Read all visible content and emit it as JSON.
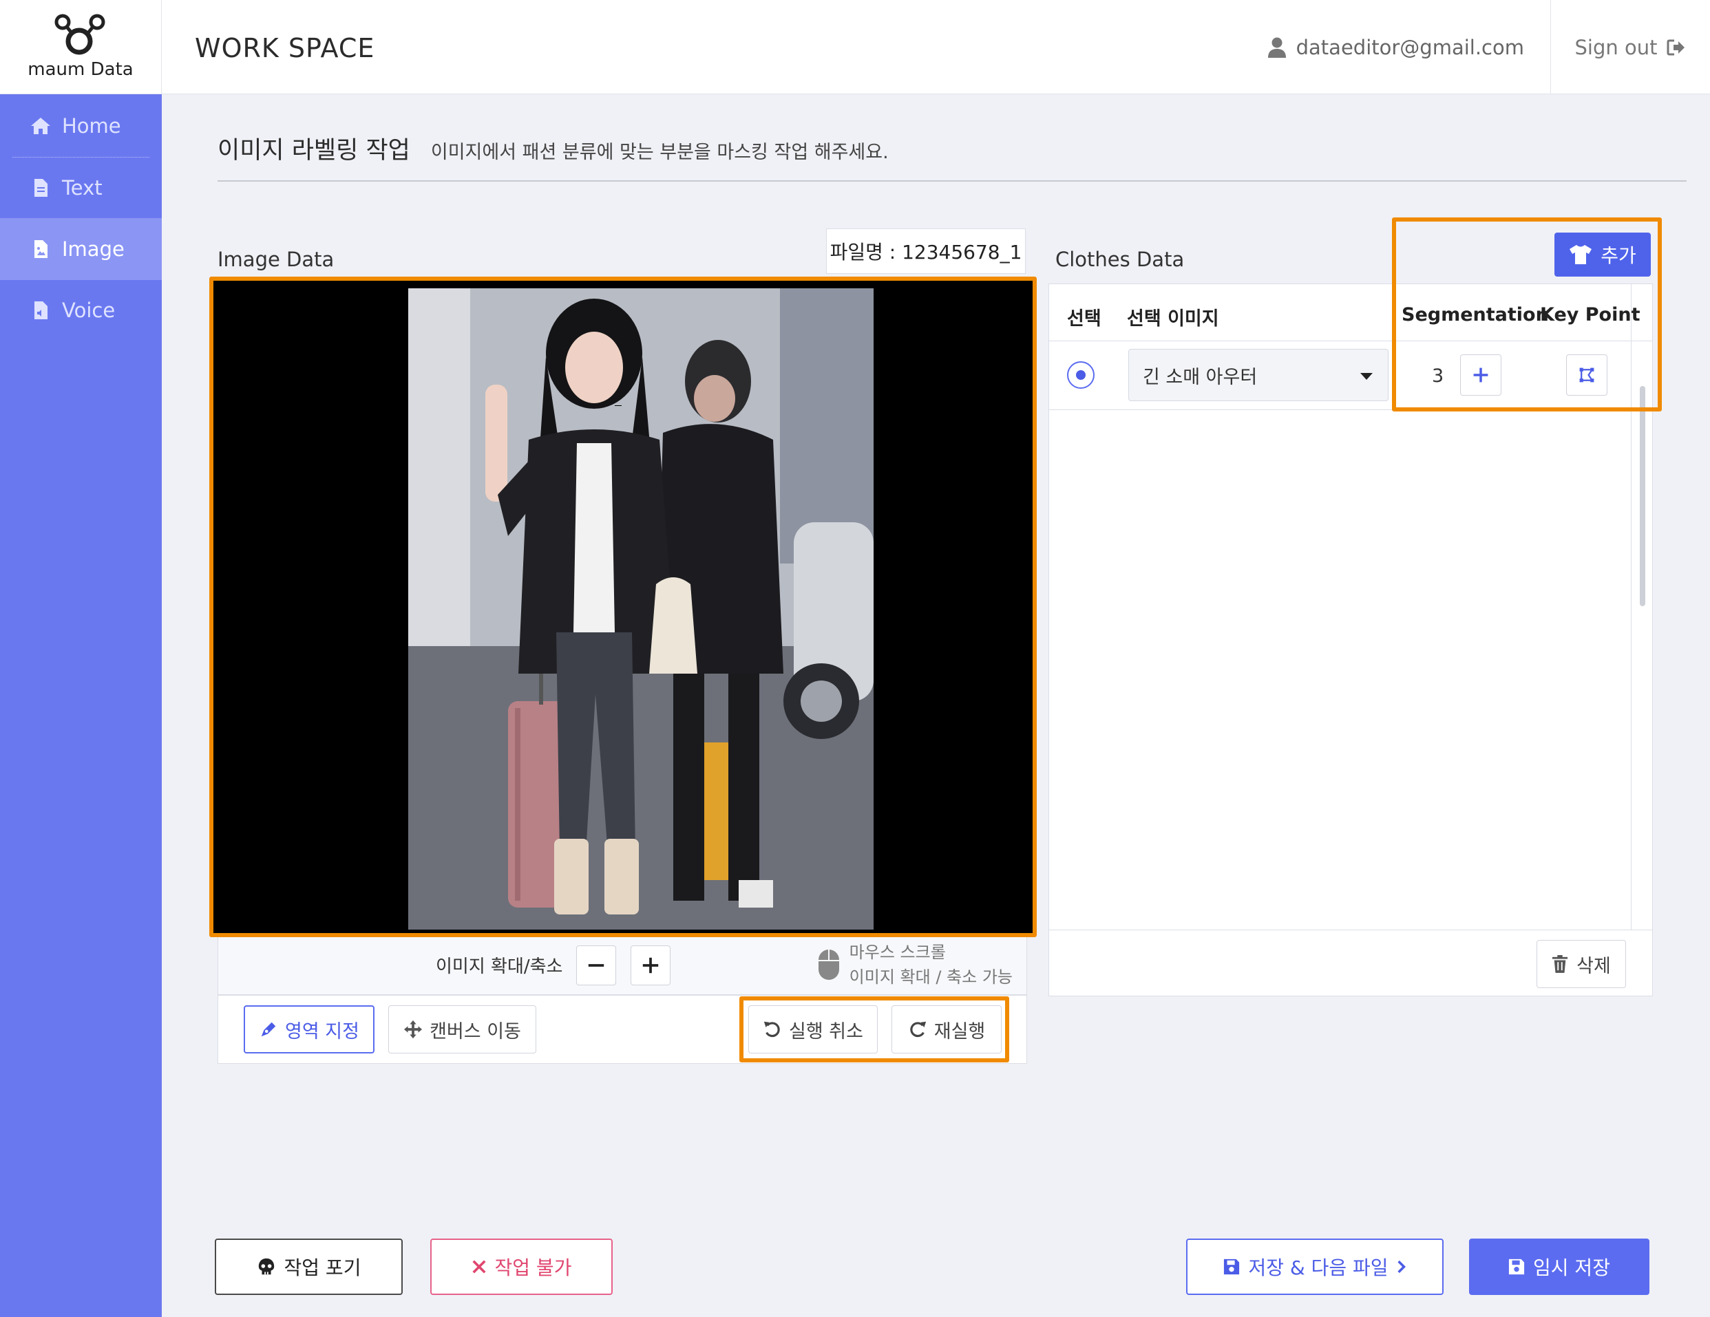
{
  "app": {
    "logo_text": "maum Data",
    "workspace_title": "WORK SPACE"
  },
  "header": {
    "user_email": "dataeditor@gmail.com",
    "signout_label": "Sign out"
  },
  "sidebar": {
    "items": [
      {
        "label": "Home",
        "icon": "home-icon"
      },
      {
        "label": "Text",
        "icon": "document-icon"
      },
      {
        "label": "Image",
        "icon": "image-file-icon",
        "active": true
      },
      {
        "label": "Voice",
        "icon": "audio-file-icon"
      }
    ]
  },
  "page": {
    "title": "이미지 라벨링 작업",
    "subtitle": "이미지에서  패션 분류에 맞는 부분을 마스킹 작업 해주세요."
  },
  "image_panel": {
    "label": "Image Data",
    "file_name": "파일명 : 12345678_1",
    "zoom_label": "이미지 확대/축소",
    "mouse_hint_line1": "마우스 스크롤",
    "mouse_hint_line2": "이미지 확대 / 축소 가능",
    "tools": {
      "select_area": "영역 지정",
      "move_canvas": "캔버스 이동",
      "undo": "실행 취소",
      "redo": "재실행"
    }
  },
  "clothes_panel": {
    "label": "Clothes Data",
    "add_label": "추가",
    "columns": {
      "select": "선택",
      "image": "선택 이미지",
      "segmentation": "Segmentation",
      "keypoint": "Key Point"
    },
    "rows": [
      {
        "selected": true,
        "category": "긴 소매 아우터",
        "segmentation_count": "3"
      }
    ],
    "delete_label": "삭제"
  },
  "footer": {
    "give_up": "작업 포기",
    "reject": "작업 불가",
    "save_next": "저장 & 다음 파일",
    "temp_save": "임시 저장"
  },
  "colors": {
    "accent": "#5b6cf0",
    "sidebar": "#6a78f0",
    "highlight": "#f08a00",
    "danger": "#e0466f"
  }
}
